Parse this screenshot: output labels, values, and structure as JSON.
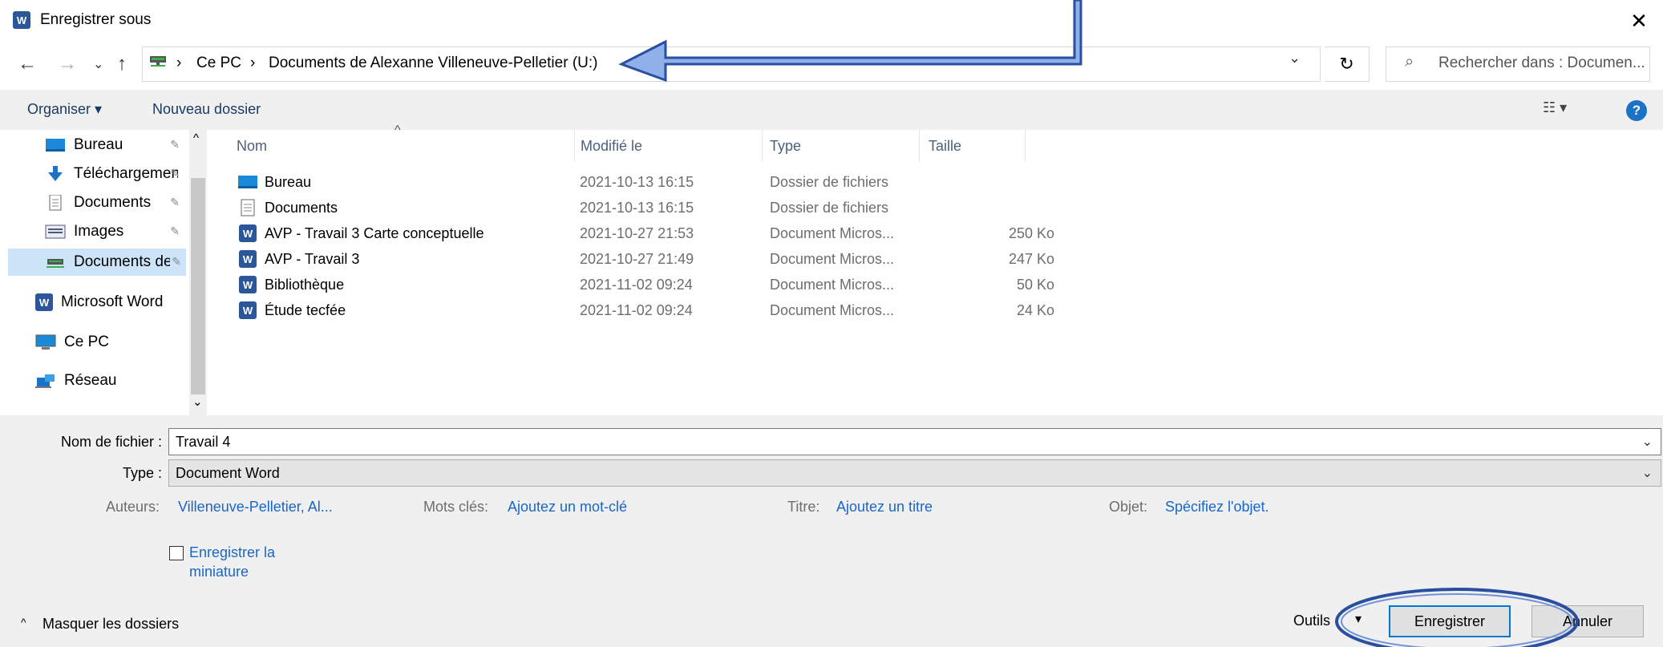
{
  "window": {
    "title": "Enregistrer sous",
    "app_icon": "word-icon",
    "close_glyph": "✕"
  },
  "nav_buttons": {
    "back": "←",
    "forward": "→",
    "recent": "⌄",
    "up": "↑"
  },
  "address": {
    "separator": "›",
    "crumbs": [
      "Ce PC",
      "Documents de Alexanne Villeneuve-Pelletier (U:)"
    ],
    "dropdown": "⌄",
    "refresh": "↻"
  },
  "search": {
    "icon": "⌕",
    "placeholder": "Rechercher dans : Documen..."
  },
  "commandbar": {
    "organize": "Organiser ▾",
    "new_folder": "Nouveau dossier",
    "view_glyph": "☷ ▾",
    "help": "?"
  },
  "sidebar": {
    "items": [
      {
        "label": "Bureau",
        "icon": "desktop-icon",
        "pinned": true
      },
      {
        "label": "Téléchargements",
        "icon": "download-icon",
        "pinned": true
      },
      {
        "label": "Documents",
        "icon": "document-icon",
        "pinned": true
      },
      {
        "label": "Images",
        "icon": "image-icon",
        "pinned": true
      },
      {
        "label": "Documents de Alexanne",
        "icon": "network-drive-icon",
        "pinned": true,
        "selected": true
      },
      {
        "label": "Microsoft Word",
        "icon": "word-icon"
      },
      {
        "label": "Ce PC",
        "icon": "computer-icon"
      },
      {
        "label": "Réseau",
        "icon": "network-icon"
      }
    ],
    "pin_glyph": "📌",
    "scroll_up": "^",
    "scroll_down": "⌄"
  },
  "filelist": {
    "sort_indicator": "^",
    "columns": [
      "Nom",
      "Modifié le",
      "Type",
      "Taille"
    ],
    "rows": [
      {
        "name": "Bureau",
        "icon": "folder-desktop-icon",
        "modified": "2021-10-13 16:15",
        "type": "Dossier de fichiers",
        "size": ""
      },
      {
        "name": "Documents",
        "icon": "folder-documents-icon",
        "modified": "2021-10-13 16:15",
        "type": "Dossier de fichiers",
        "size": ""
      },
      {
        "name": "AVP - Travail 3 Carte conceptuelle",
        "icon": "word-doc-icon",
        "modified": "2021-10-27 21:53",
        "type": "Document Micros...",
        "size": "250 Ko"
      },
      {
        "name": "AVP - Travail 3",
        "icon": "word-doc-icon",
        "modified": "2021-10-27 21:49",
        "type": "Document Micros...",
        "size": "247 Ko"
      },
      {
        "name": "Bibliothèque",
        "icon": "word-doc-icon",
        "modified": "2021-11-02 09:24",
        "type": "Document Micros...",
        "size": "50 Ko"
      },
      {
        "name": "Étude tecfée",
        "icon": "word-doc-icon",
        "modified": "2021-11-02 09:24",
        "type": "Document Micros...",
        "size": "24 Ko"
      }
    ]
  },
  "form": {
    "filename_label": "Nom de fichier :",
    "filename_value": "Travail 4",
    "type_label": "Type :",
    "type_value": "Document Word",
    "chevron": "⌄",
    "authors_label": "Auteurs:",
    "authors_value": "Villeneuve-Pelletier, Al...",
    "keywords_label": "Mots clés:",
    "keywords_value": "Ajoutez un mot-clé",
    "title_label": "Titre:",
    "title_value": "Ajoutez un titre",
    "subject_label": "Objet:",
    "subject_value": "Spécifiez l'objet.",
    "thumbnail_label": "Enregistrer la miniature"
  },
  "footer": {
    "hide_folders": "Masquer les dossiers",
    "hide_glyph": "^",
    "tools": "Outils",
    "tools_dd": "▾",
    "save": "Enregistrer",
    "cancel": "Annuler"
  },
  "colors": {
    "accent": "#0078d7",
    "link": "#1a66c8",
    "annotation": "#2a4ea0",
    "annotation_fill": "#8fb0e8"
  }
}
